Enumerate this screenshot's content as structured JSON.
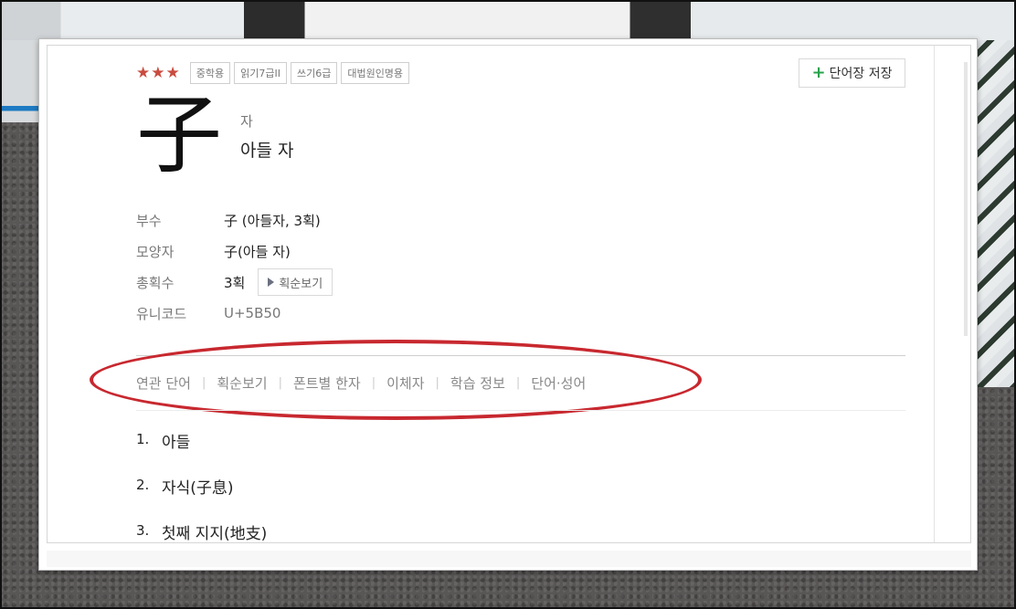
{
  "header": {
    "stars": "★★★",
    "tags": [
      "중학용",
      "읽기7급II",
      "쓰기6급",
      "대법원인명용"
    ],
    "save_label": "단어장 저장",
    "save_plus": "+"
  },
  "entry": {
    "hanja": "子",
    "reading": "자",
    "meaning": "아들 자"
  },
  "info": {
    "radical_label": "부수",
    "radical_value": "子 (아들자, 3획)",
    "shape_label": "모양자",
    "shape_value": "子(아들 자)",
    "strokes_label": "총획수",
    "strokes_value": "3획",
    "stroke_order_button": "획순보기",
    "unicode_label": "유니코드",
    "unicode_value": "U+5B50"
  },
  "subnav": {
    "items": [
      "연관 단어",
      "획순보기",
      "폰트별 한자",
      "이체자",
      "학습 정보",
      "단어·성어"
    ],
    "separator": "|"
  },
  "definitions": [
    {
      "num": "1.",
      "text": "아들"
    },
    {
      "num": "2.",
      "text": "자식(子息)"
    },
    {
      "num": "3.",
      "text": "첫째 지지(地支)"
    }
  ],
  "colors": {
    "star": "#c94c3f",
    "highlight": "#c8282f",
    "plus": "#26a34b"
  }
}
